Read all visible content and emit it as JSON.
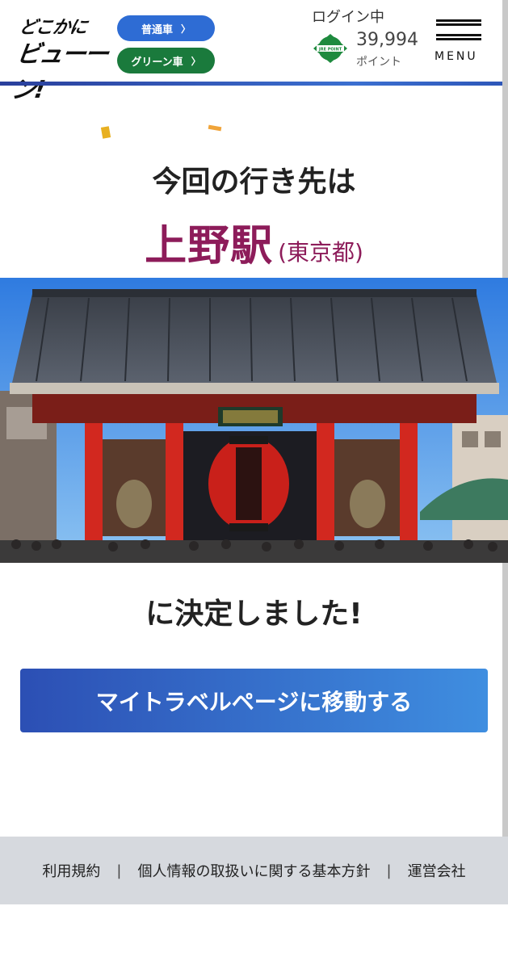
{
  "header": {
    "logo_line1": "どこかに",
    "logo_line2": "ビューーン!",
    "btn_standard": "普通車",
    "btn_green": "グリーン車",
    "chevron": "〉",
    "login_status": "ログイン中",
    "points_value": "39,994",
    "points_unit": "ポイント",
    "jre_icon_label": "JRE POINT",
    "menu_label": "MENU"
  },
  "main": {
    "lead": "今回の行き先は",
    "destination": "上野駅",
    "prefecture": "(東京都)",
    "decided": "に決定しました!",
    "cta_label": "マイトラベルページに移動する"
  },
  "footer": {
    "links": [
      "利用規約",
      "個人情報の取扱いに関する基本方針",
      "運営会社"
    ],
    "separator": "|"
  },
  "colors": {
    "accent_blue": "#2e6cd4",
    "green": "#1a7a3c",
    "destination": "#8d1c5a",
    "footer_bg": "#d6d9de"
  }
}
